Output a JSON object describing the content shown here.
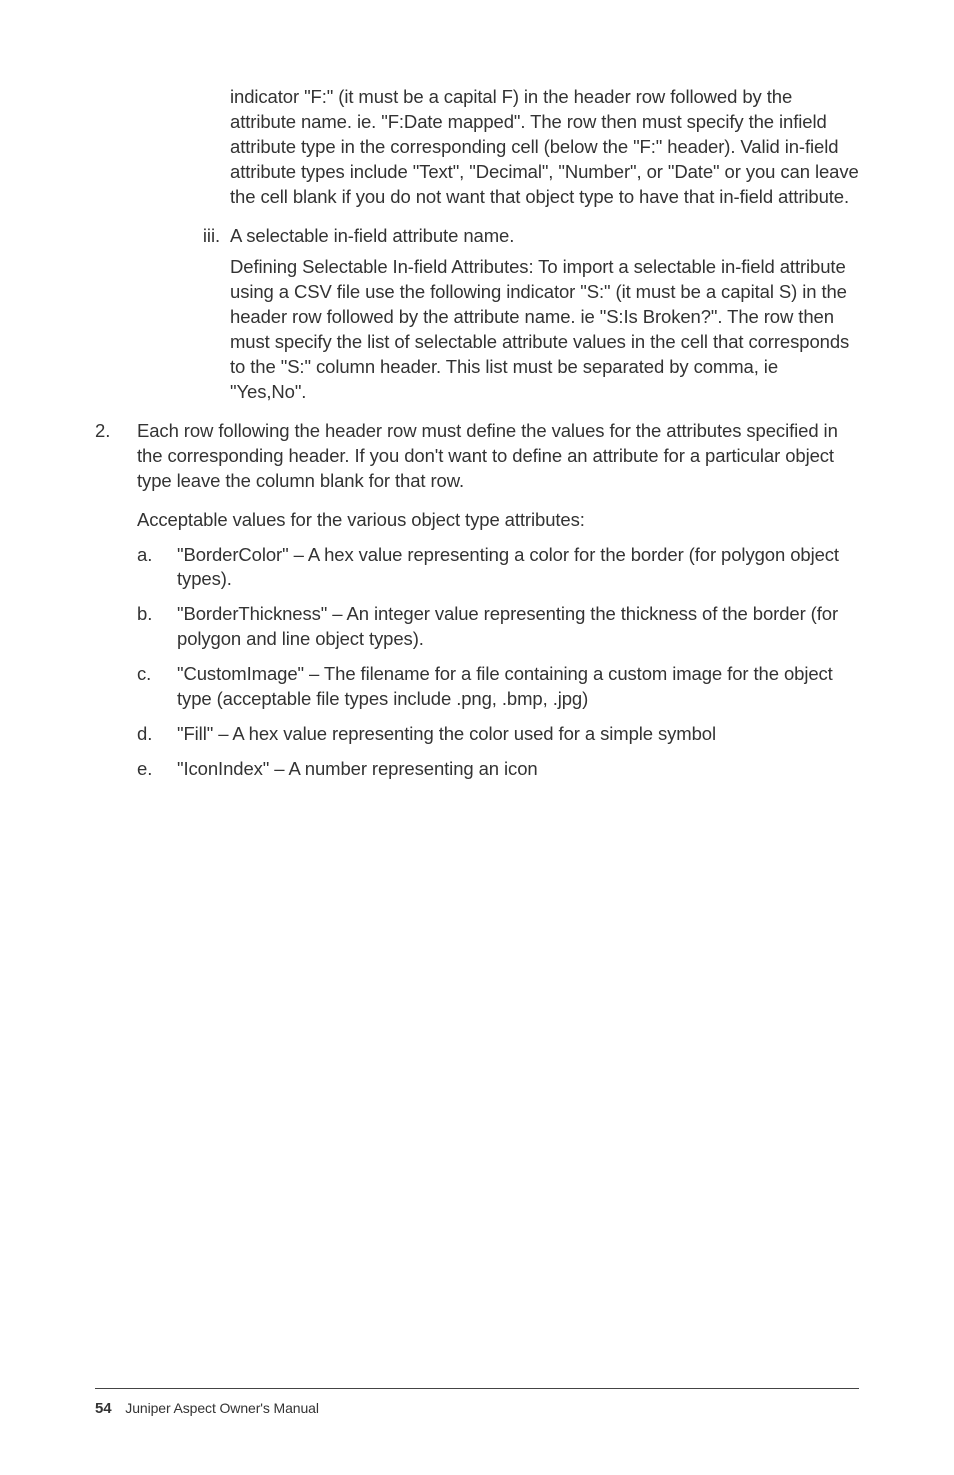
{
  "continuation_ii": "indicator \"F:\" (it must be a capital F) in the header row followed by the attribute name. ie. \"F:Date mapped\". The row then must specify the infield attribute type in the corresponding cell (below the \"F:\" header). Valid in-field attribute types include \"Text\", \"Decimal\", \"Number\", or \"Date\" or you can leave the cell blank if you do not want that object type to have that in-field attribute.",
  "item_iii": {
    "marker": "iii.",
    "para1": "A selectable in-field attribute name.",
    "para2": "Defining Selectable In-field Attributes: To import a selectable in-field attribute using a CSV file use the following indicator \"S:\" (it must be a capital S) in the header row followed by the attribute name. ie \"S:Is Broken?\". The row then must specify the list of selectable attribute values in the cell that corresponds to the \"S:\" column header. This list must be separated by comma, ie \"Yes,No\"."
  },
  "item_2": {
    "marker": "2.",
    "para1": "Each row following the header row must define the values for the attributes specified in the corresponding header. If you don't want to define an attribute for a particular object type leave the column blank for that row.",
    "para2": "Acceptable values for the various object type attributes:",
    "sub": {
      "a": {
        "marker": "a.",
        "text": "\"BorderColor\" – A hex value representing a color for the border (for polygon object types)."
      },
      "b": {
        "marker": "b.",
        "text": "\"BorderThickness\" – An integer value representing the thickness of the border (for polygon and line object types)."
      },
      "c": {
        "marker": "c.",
        "text": "\"CustomImage\" – The filename for a file containing a custom image for the object type (acceptable file types include .png, .bmp, .jpg)"
      },
      "d": {
        "marker": "d.",
        "text": "\"Fill\" – A hex value representing the color used for a simple symbol"
      },
      "e": {
        "marker": "e.",
        "text": "\"IconIndex\" – A number representing an icon"
      }
    }
  },
  "footer": {
    "page": "54",
    "title": "Juniper Aspect Owner's Manual"
  }
}
